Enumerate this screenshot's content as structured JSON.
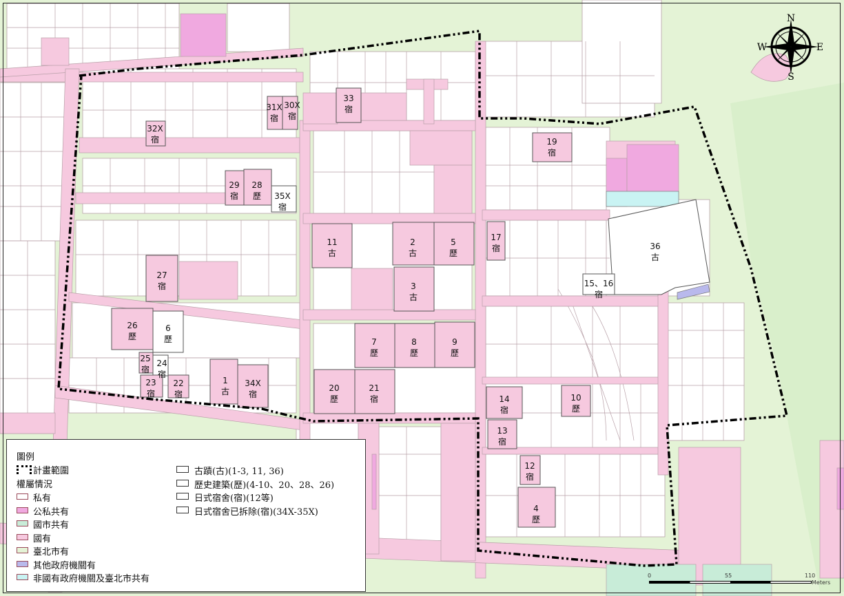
{
  "colors": {
    "private": "#ffffff",
    "public_private": "#f0a9e0",
    "state_city": "#c8ecd8",
    "state": "#f6c9df",
    "taipei_city": "#e4f3d6",
    "other_gov": "#b9b9ec",
    "non_state_gov_city": "#c9f3f3",
    "parcel_line": "#b8a0a8",
    "boundary": "#000000",
    "building_outline": "#555555"
  },
  "compass": {
    "n": "N",
    "s": "S",
    "e": "E",
    "w": "W"
  },
  "sites": [
    {
      "num": "33",
      "type": "宿"
    },
    {
      "num": "31X",
      "type": "宿"
    },
    {
      "num": "30X",
      "type": "宿"
    },
    {
      "num": "32X",
      "type": "宿"
    },
    {
      "num": "19",
      "type": "宿"
    },
    {
      "num": "29",
      "type": "宿"
    },
    {
      "num": "28",
      "type": "歷"
    },
    {
      "num": "35X",
      "type": "宿"
    },
    {
      "num": "11",
      "type": "古"
    },
    {
      "num": "2",
      "type": "古"
    },
    {
      "num": "5",
      "type": "歷"
    },
    {
      "num": "17",
      "type": "宿"
    },
    {
      "num": "36",
      "type": "古"
    },
    {
      "num": "27",
      "type": "宿"
    },
    {
      "num": "3",
      "type": "古"
    },
    {
      "num": "15、16",
      "type": "宿"
    },
    {
      "num": "26",
      "type": "歷"
    },
    {
      "num": "6",
      "type": "歷"
    },
    {
      "num": "7",
      "type": "歷"
    },
    {
      "num": "8",
      "type": "歷"
    },
    {
      "num": "9",
      "type": "歷"
    },
    {
      "num": "25",
      "type": "宿"
    },
    {
      "num": "24",
      "type": "宿"
    },
    {
      "num": "23",
      "type": "宿"
    },
    {
      "num": "22",
      "type": "宿"
    },
    {
      "num": "1",
      "type": "古"
    },
    {
      "num": "34X",
      "type": "宿"
    },
    {
      "num": "20",
      "type": "歷"
    },
    {
      "num": "21",
      "type": "宿"
    },
    {
      "num": "14",
      "type": "宿"
    },
    {
      "num": "10",
      "type": "歷"
    },
    {
      "num": "13",
      "type": "宿"
    },
    {
      "num": "12",
      "type": "宿"
    },
    {
      "num": "4",
      "type": "歷"
    }
  ],
  "legend": {
    "title": "圖例",
    "plan_boundary": "計畫範圍",
    "ownership_title": "權屬情況",
    "ownership": [
      {
        "label": "私有",
        "key": "private"
      },
      {
        "label": "公私共有",
        "key": "public_private"
      },
      {
        "label": "國市共有",
        "key": "state_city"
      },
      {
        "label": "國有",
        "key": "state"
      },
      {
        "label": "臺北市有",
        "key": "taipei_city"
      },
      {
        "label": "其他政府機關有",
        "key": "other_gov"
      },
      {
        "label": "非國有政府機關及臺北市共有",
        "key": "non_state_gov_city"
      }
    ],
    "site_types": [
      "古蹟(古)(1-3, 11, 36)",
      "歷史建築(歷)(4-10、20、28、26)",
      "日式宿舍(宿)(12等)",
      "日式宿舍已拆除(宿)(34X-35X)"
    ]
  },
  "scalebar": {
    "ticks": [
      "0",
      "55",
      "110"
    ],
    "unit": "Meters"
  }
}
